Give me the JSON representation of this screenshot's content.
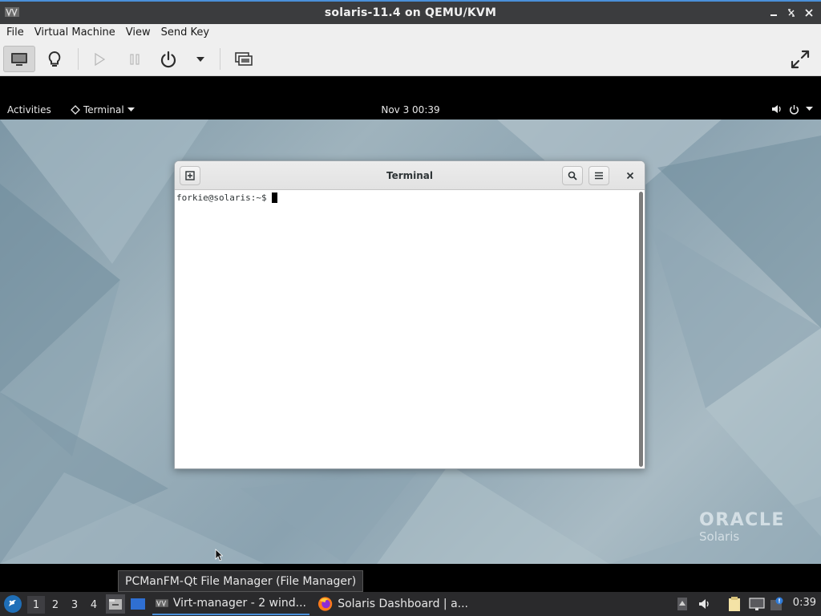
{
  "window": {
    "title": "solaris-11.4 on QEMU/KVM",
    "controls": [
      "minimize",
      "maximize",
      "close"
    ]
  },
  "menubar": {
    "items": [
      "File",
      "Virtual Machine",
      "View",
      "Send Key"
    ]
  },
  "toolbar": {
    "buttons": [
      {
        "icon": "console-icon",
        "state": "active"
      },
      {
        "icon": "lightbulb-icon"
      },
      {
        "icon": "play-icon",
        "state": "disabled"
      },
      {
        "icon": "pause-icon",
        "state": "disabled"
      },
      {
        "icon": "power-icon"
      },
      {
        "icon": "dropdown-arrow-icon"
      },
      {
        "icon": "snapshots-icon"
      },
      {
        "icon": "fullscreen-icon"
      }
    ]
  },
  "guest": {
    "topbar": {
      "activities": "Activities",
      "app_menu": "Terminal",
      "clock": "Nov 3  00:39",
      "icons": [
        "volume-icon",
        "power-icon",
        "chevron-down-icon"
      ]
    },
    "terminal": {
      "title": "Terminal",
      "prompt": "forkie@solaris:~$"
    },
    "logo": {
      "brand": "ORACLE",
      "product": "Solaris"
    }
  },
  "host_taskbar": {
    "tooltip": "PCManFM-Qt File Manager (File Manager)",
    "workspaces": [
      "1",
      "2",
      "3",
      "4"
    ],
    "current_workspace": "1",
    "tasks": [
      {
        "label": "Virt-manager - 2 wind...",
        "icon": "virt-manager-icon",
        "active": true
      },
      {
        "label": "Solaris Dashboard | a...",
        "icon": "firefox-icon",
        "active": false
      }
    ],
    "clock": "0:39"
  },
  "colors": {
    "accent": "#4a90d9",
    "titlebar": "#3b3c3e",
    "taskbar": "#2a2a2c",
    "desktop": "#9fb3bd"
  }
}
